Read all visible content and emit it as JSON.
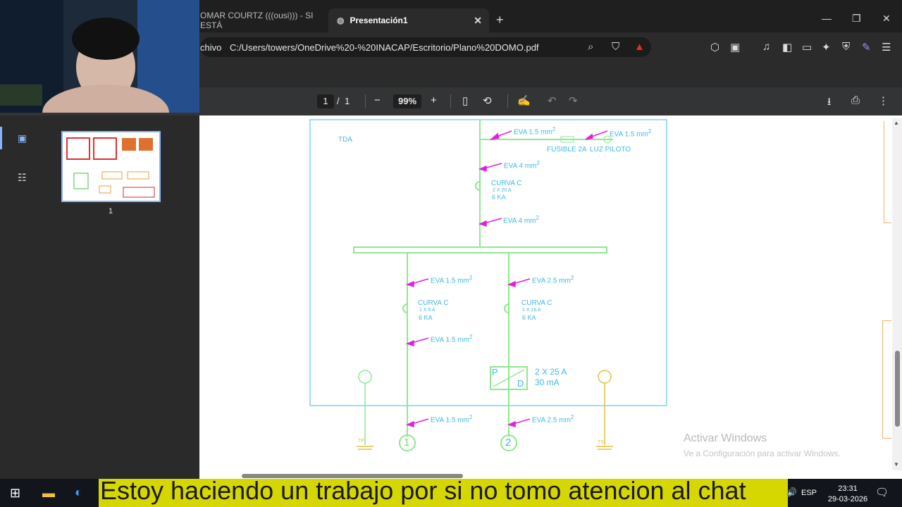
{
  "browser": {
    "tabs": [
      {
        "label": "OMAR COURTZ (((ousi))) - SI ESTÁ",
        "active": false
      },
      {
        "label": "Presentación1",
        "active": true
      }
    ],
    "address_prefix": "chivo",
    "url": "C:/Users/towers/OneDrive%20-%20INACAP/Escritorio/Plano%20DOMO.pdf"
  },
  "pdf_toolbar": {
    "page_current": "1",
    "page_separator": "/",
    "page_total": "1",
    "zoom": "99%"
  },
  "sidebar": {
    "thumbnail_page_number": "1"
  },
  "schematic": {
    "tda_label": "TDA",
    "top_cable": "EVA 1.5 mm",
    "right_cable": "EVA 1.5 mm",
    "fuse_label": "FUSIBLE 2A",
    "pilot_label": "LUZ PILOTO",
    "main_cable_top": "EVA 4 mm",
    "main_breaker_title": "CURVA C",
    "main_breaker_spec1": "2 X 20 A",
    "main_breaker_spec2": "6 KA",
    "main_cable_bottom": "EVA 4 mm",
    "circuit1_cable_top": "EVA 1.5 mm",
    "circuit1_breaker_title": "CURVA C",
    "circuit1_breaker_spec1": "1 X 6 A",
    "circuit1_breaker_spec2": "6 KA",
    "circuit1_cable_mid": "EVA 1.5 mm",
    "circuit2_cable_top": "EVA 2.5 mm",
    "circuit2_breaker_title": "CURVA C",
    "circuit2_breaker_spec1": "1 X 16 A",
    "circuit2_breaker_spec2": "6 KA",
    "rcd_label_p": "P",
    "rcd_label_d": "D",
    "rcd_spec1": "2 X 25 A",
    "rcd_spec2": "30 mA",
    "circuit1_cable_out": "EVA 1.5 mm",
    "circuit2_cable_out": "EVA 2.5 mm",
    "circuit1_number": "1",
    "circuit2_number": "2",
    "ground_tp": "TP",
    "ground_ts": "TS",
    "unit_exponent": "2"
  },
  "watermark": {
    "line1": "Activar Windows",
    "line2": "Ve a Configuración para activar Windows."
  },
  "taskbar": {
    "caption": "Estoy haciendo un trabajo por si no tomo atencion al chat",
    "language": "ESP",
    "time": "23:31",
    "date": "29-03-2026"
  },
  "colors": {
    "schematic_text": "#41b8e6",
    "schematic_line": "#8fe88f",
    "arrow": "#e020e0",
    "ground": "#e0c040",
    "caption_bg": "#d6d600"
  }
}
